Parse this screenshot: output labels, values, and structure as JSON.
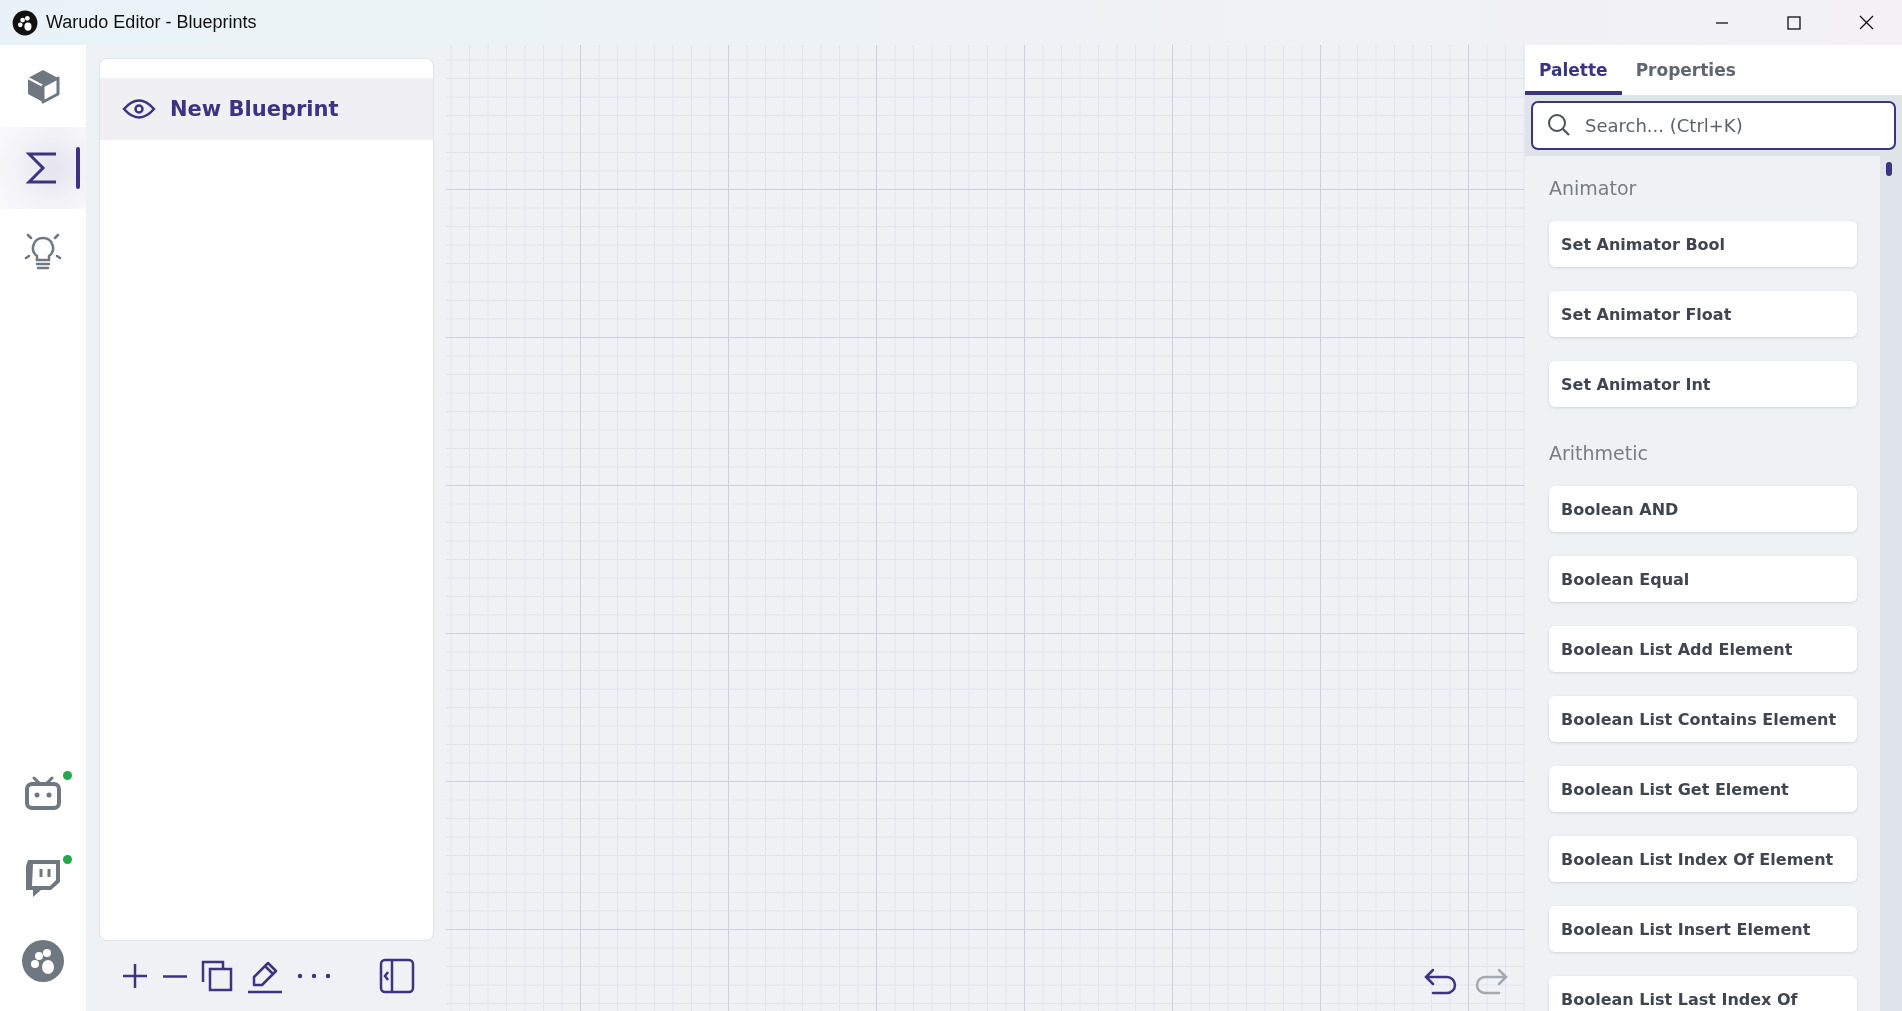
{
  "window": {
    "title": "Warudo Editor - Blueprints"
  },
  "rail": {
    "items": [
      {
        "kind": "cube",
        "selected": false
      },
      {
        "kind": "sigma",
        "selected": true
      },
      {
        "kind": "bulb",
        "selected": false
      }
    ],
    "bottom": [
      {
        "kind": "bot",
        "online": true
      },
      {
        "kind": "chat",
        "online": true
      },
      {
        "kind": "paw"
      }
    ]
  },
  "blueprints": [
    {
      "name": "New Blueprint",
      "selected": true
    }
  ],
  "history": {
    "undo": {
      "disabled": false
    },
    "redo": {
      "disabled": true
    }
  },
  "palette": {
    "tabs": [
      {
        "label": "Palette",
        "selected": true
      },
      {
        "label": "Properties",
        "selected": false
      }
    ],
    "search": {
      "placeholder": "Search... (Ctrl+K)"
    },
    "groups": [
      {
        "title": "Animator",
        "items": [
          "Set Animator Bool",
          "Set Animator Float",
          "Set Animator Int"
        ]
      },
      {
        "title": "Arithmetic",
        "items": [
          "Boolean AND",
          "Boolean Equal",
          "Boolean List Add Element",
          "Boolean List Contains Element",
          "Boolean List Get Element",
          "Boolean List Index Of Element",
          "Boolean List Insert Element",
          "Boolean List Last Index Of"
        ]
      }
    ]
  }
}
